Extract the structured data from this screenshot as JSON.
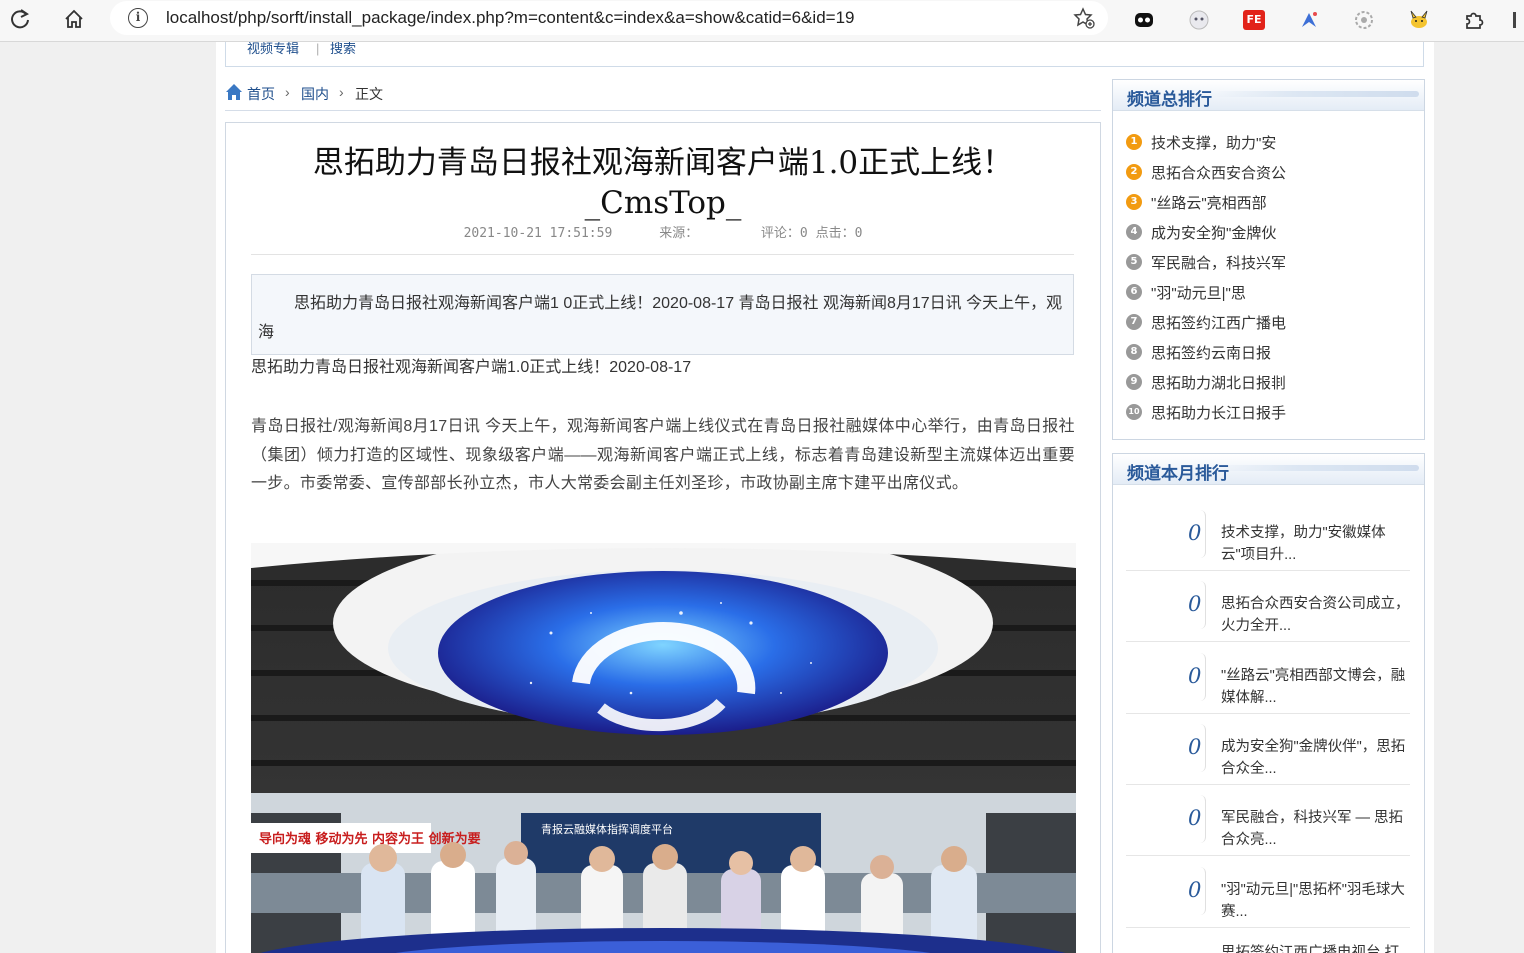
{
  "browser": {
    "url": "localhost/php/sorft/install_package/index.php?m=content&c=index&a=show&catid=6&id=19",
    "ext_fe_label": "FE"
  },
  "topnav": {
    "items": [
      "视频专辑",
      "搜索"
    ],
    "separator": "|"
  },
  "breadcrumb": {
    "home": "首页",
    "category": "国内",
    "current": "正文",
    "arrow": "›"
  },
  "article": {
    "title_line1": "思拓助力青岛日报社观海新闻客户端1.0正式上线！",
    "title_line2": "_CmsTop_",
    "date": "2021-10-21 17:51:59",
    "source_label": "来源：",
    "source": "",
    "comments_label": "评论：",
    "comments": "0",
    "clicks_label": "点击：",
    "clicks": "0",
    "summary": "思拓助力青岛日报社观海新闻客户端1 0正式上线！2020-08-17 青岛日报社 观海新闻8月17日讯 今天上午，观海",
    "lead": "思拓助力青岛日报社观海新闻客户端1.0正式上线！2020-08-17",
    "body": "青岛日报社/观海新闻8月17日讯 今天上午，观海新闻客户端上线仪式在青岛日报社融媒体中心举行，由青岛日报社（集团）倾力打造的区域性、现象级客户端——观海新闻客户端正式上线，标志着青岛建设新型主流媒体迈出重要一步。市委常委、宣传部部长孙立杰，市人大常委会副主任刘圣珍，市政协副主席卞建平出席仪式。",
    "photo_banner": "青报云融媒体指挥调度平台",
    "photo_slogan": "导向为魂 移动为先 内容为王 创新为要"
  },
  "sidebar": {
    "total_rank": {
      "title": "频道总排行",
      "items": [
        {
          "num": "1",
          "text": "技术支撑，助力\"安",
          "color": "#f29b11"
        },
        {
          "num": "2",
          "text": "思拓合众西安合资公",
          "color": "#f29b11"
        },
        {
          "num": "3",
          "text": "\"丝路云\"亮相西部",
          "color": "#f29b11"
        },
        {
          "num": "4",
          "text": "成为安全狗\"金牌伙",
          "color": "#999999"
        },
        {
          "num": "5",
          "text": "军民融合，科技兴军",
          "color": "#999999"
        },
        {
          "num": "6",
          "text": "\"羽\"动元旦|\"思",
          "color": "#999999"
        },
        {
          "num": "7",
          "text": "思拓签约江西广播电",
          "color": "#999999"
        },
        {
          "num": "8",
          "text": "思拓签约云南日报",
          "color": "#999999"
        },
        {
          "num": "9",
          "text": "思拓助力湖北日报剕",
          "color": "#999999"
        },
        {
          "num": "10",
          "text": "思拓助力长江日报手",
          "color": "#999999"
        }
      ]
    },
    "month_rank": {
      "title": "频道本月排行",
      "items": [
        {
          "count": "0",
          "text": "技术支撑，助力\"安徽媒体云\"项目升..."
        },
        {
          "count": "0",
          "text": "思拓合众西安合资公司成立，火力全开..."
        },
        {
          "count": "0",
          "text": "\"丝路云\"亮相西部文博会，融媒体解..."
        },
        {
          "count": "0",
          "text": "成为安全狗\"金牌伙伴\"，思拓合众全..."
        },
        {
          "count": "0",
          "text": "军民融合，科技兴军 — 思拓合众亮..."
        },
        {
          "count": "0",
          "text": "\"羽\"动元旦|\"思拓杯\"羽毛球大赛..."
        },
        {
          "count": "",
          "text": "思拓签约江西广播电视台 打"
        }
      ]
    }
  },
  "colors": {
    "link": "#1e4e8c",
    "heading": "#2a5a9a",
    "rank_top": "#f29b11",
    "rank_rest": "#999999"
  }
}
